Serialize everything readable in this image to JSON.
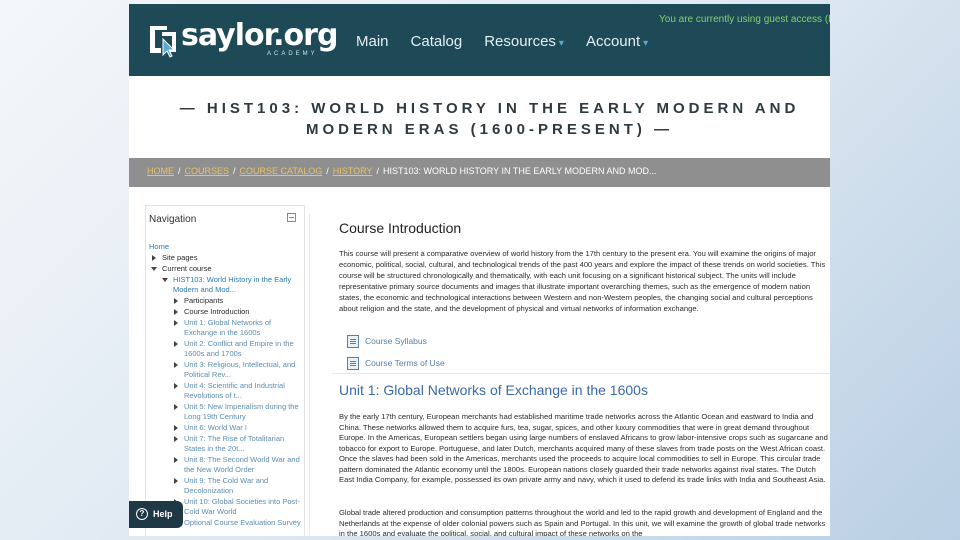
{
  "header": {
    "logo_text": "saylor.org",
    "logo_sub": "ACADEMY",
    "nav": [
      {
        "label": "Main"
      },
      {
        "label": "Catalog"
      },
      {
        "label": "Resources",
        "caret": "▾"
      },
      {
        "label": "Account",
        "caret": "▾"
      }
    ],
    "guest_notice": "You are currently using guest access (Log in)"
  },
  "course_title": "— HIST103: WORLD HISTORY IN THE EARLY MODERN AND MODERN ERAS (1600-PRESENT) —",
  "breadcrumb": {
    "items": [
      "HOME",
      "COURSES",
      "COURSE CATALOG",
      "HISTORY"
    ],
    "current": "HIST103: WORLD HISTORY IN THE EARLY MODERN AND MOD...",
    "separator": "/"
  },
  "navigation": {
    "heading": "Navigation",
    "home": "Home",
    "site_pages": "Site pages",
    "current_course": "Current course",
    "course": "HIST103: World History in the Early Modern and Mod...",
    "participants": "Participants",
    "course_intro": "Course Introduction",
    "units": [
      "Unit 1: Global Networks of Exchange in the 1600s",
      "Unit 2: Conflict and Empire in the 1600s and 1700s",
      "Unit 3: Religious, Intellectual, and Political Rev...",
      "Unit 4: Scientific and Industrial Revolutions of t...",
      "Unit 5: New Imperialism during the Long 19th Century",
      "Unit 6: World War I",
      "Unit 7: The Rise of Totalitarian States in the 20t...",
      "Unit 8: The Second World War and the New World Order",
      "Unit 9: The Cold War and Decolonization",
      "Unit 10: Global Societies into Post-Cold War World",
      "Optional Course Evaluation Survey"
    ]
  },
  "help": {
    "label": "Help"
  },
  "main": {
    "intro_title": "Course Introduction",
    "intro_text": "This course will present a comparative overview of world history from the 17th century to the present era. You will examine the origins of major economic, political, social, cultural, and technological trends of the past 400 years and explore the impact of these trends on world societies. This course will be structured chronologically and thematically, with each unit focusing on a significant historical subject. The units will include representative primary source documents and images that illustrate important overarching themes, such as the emergence of modern nation states, the economic and technological interactions between Western and non-Western peoples, the changing social and cultural perceptions about religion and the state, and the development of physical and virtual networks of information exchange.",
    "resources": [
      "Course Syllabus",
      "Course Terms of Use"
    ],
    "unit1_title": "Unit 1: Global Networks of Exchange in the 1600s",
    "unit1_p1": "By the early 17th century, European merchants had established maritime trade networks across the Atlantic Ocean and eastward to India and China. These networks allowed them to acquire furs, tea, sugar, spices, and other luxury commodities that were in great demand throughout Europe. In the Americas, European settlers began using large numbers of enslaved Africans to grow labor-intensive crops such as sugarcane and tobacco for export to Europe. Portuguese, and later Dutch, merchants acquired many of these slaves from trade posts on the West African coast. Once the slaves had been sold in the Americas, merchants used the proceeds to acquire local commodities to sell in Europe. This circular trade pattern dominated the Atlantic economy until the 1800s. European nations closely guarded their trade networks against rival states. The Dutch East India Company, for example, possessed its own private army and navy, which it used to defend its trade links with India and Southeast Asia.",
    "unit1_p2": "Global trade altered production and consumption patterns throughout the world and led to the rapid growth and development of England and the Netherlands at the expense of older colonial powers such as Spain and Portugal. In this unit, we will examine the growth of global trade networks in the 1600s and evaluate the political, social, and cultural impact of these networks on the"
  }
}
